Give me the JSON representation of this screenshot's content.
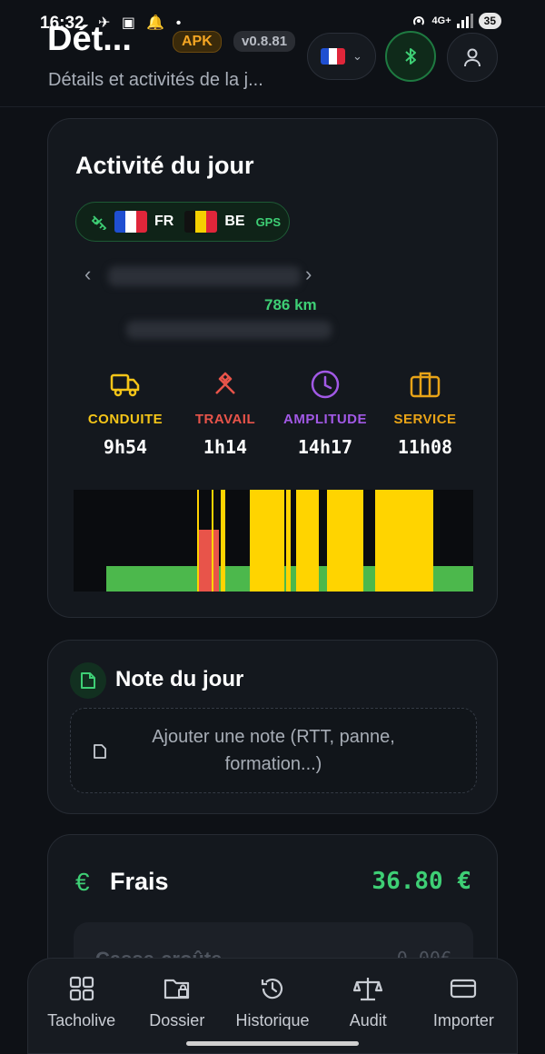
{
  "status": {
    "time": "16:32",
    "network": "4G+",
    "battery": "35"
  },
  "header": {
    "title": "Dét...",
    "apk_badge": "APK",
    "version": "v0.8.81",
    "subtitle": "Détails et activités de la j..."
  },
  "activity": {
    "title": "Activité du jour",
    "countries": [
      {
        "code": "FR",
        "colors": [
          "#1f4fd1",
          "#ffffff",
          "#e0263a"
        ]
      },
      {
        "code": "BE",
        "colors": [
          "#111111",
          "#f5d000",
          "#e0263a"
        ]
      }
    ],
    "gps_label": "GPS",
    "distance": "786 km",
    "stats": [
      {
        "label": "CONDUITE",
        "value": "9h54",
        "color": "#f5c518",
        "icon": "truck-icon"
      },
      {
        "label": "TRAVAIL",
        "value": "1h14",
        "color": "#e8544a",
        "icon": "hammers-icon"
      },
      {
        "label": "AMPLITUDE",
        "value": "14h17",
        "color": "#a259e6",
        "icon": "clock-icon"
      },
      {
        "label": "SERVICE",
        "value": "11h08",
        "color": "#e8a317",
        "icon": "briefcase-icon"
      }
    ],
    "timeline_colors": {
      "rest": "#4cb84c",
      "driving": "#ffd400",
      "work": "#e8544a",
      "background": "#0a0c0f"
    }
  },
  "note": {
    "title": "Note du jour",
    "placeholder": "Ajouter une note (RTT, panne, formation...)"
  },
  "frais": {
    "title": "Frais",
    "currency_symbol": "€",
    "total": "36.80 €",
    "first_row_label": "Casse-croûte",
    "first_row_value": "0.00€"
  },
  "bottom_nav": [
    {
      "label": "Tacholive",
      "icon": "grid-icon"
    },
    {
      "label": "Dossier",
      "icon": "folder-lock-icon"
    },
    {
      "label": "Historique",
      "icon": "history-icon"
    },
    {
      "label": "Audit",
      "icon": "scale-icon"
    },
    {
      "label": "Importer",
      "icon": "card-icon"
    }
  ]
}
